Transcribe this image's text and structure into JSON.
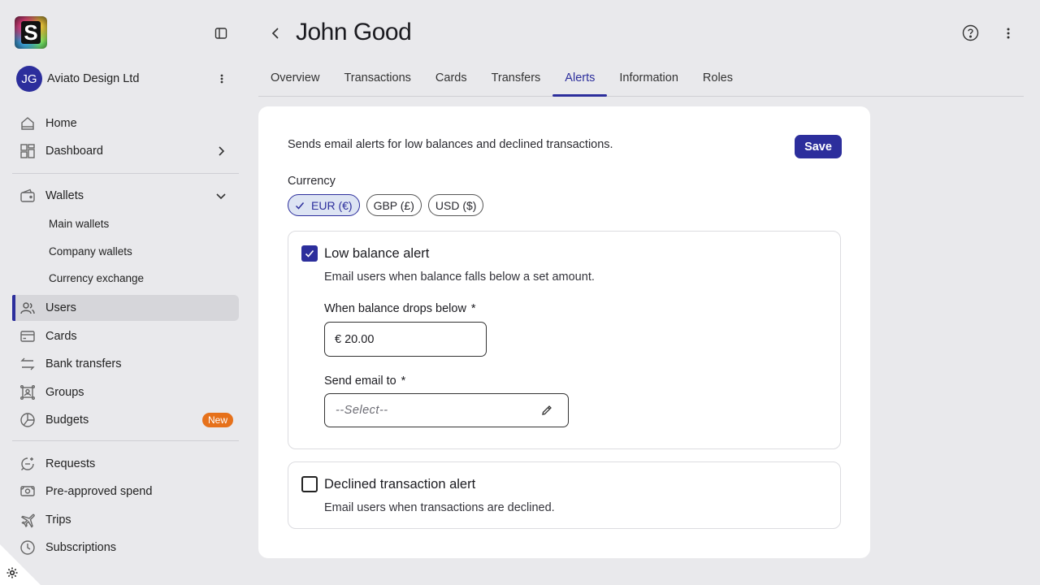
{
  "app": {
    "logo_letter": "S"
  },
  "org": {
    "initials": "JG",
    "name": "Aviato Design Ltd"
  },
  "sidebar": {
    "items": [
      {
        "key": "home",
        "label": "Home",
        "icon": "home-icon"
      },
      {
        "key": "dashboard",
        "label": "Dashboard",
        "icon": "dashboard-icon"
      },
      {
        "key": "wallets",
        "label": "Wallets",
        "icon": "wallet-icon"
      },
      {
        "key": "users",
        "label": "Users",
        "icon": "users-icon",
        "active": true
      },
      {
        "key": "cards",
        "label": "Cards",
        "icon": "card-icon"
      },
      {
        "key": "bank-transfers",
        "label": "Bank transfers",
        "icon": "transfer-icon"
      },
      {
        "key": "groups",
        "label": "Groups",
        "icon": "groups-icon"
      },
      {
        "key": "budgets",
        "label": "Budgets",
        "icon": "budget-icon",
        "badge": "New"
      },
      {
        "key": "requests",
        "label": "Requests",
        "icon": "requests-icon"
      },
      {
        "key": "pre-approved",
        "label": "Pre-approved spend",
        "icon": "pre-approved-icon"
      },
      {
        "key": "trips",
        "label": "Trips",
        "icon": "plane-icon"
      },
      {
        "key": "subscriptions",
        "label": "Subscriptions",
        "icon": "clock-icon"
      }
    ],
    "wallet_subitems": [
      "Main wallets",
      "Company wallets",
      "Currency exchange"
    ]
  },
  "header": {
    "title": "John Good",
    "tabs": [
      "Overview",
      "Transactions",
      "Cards",
      "Transfers",
      "Alerts",
      "Information",
      "Roles"
    ],
    "active_tab": "Alerts"
  },
  "alerts": {
    "description": "Sends email alerts for low balances and declined transactions.",
    "save_label": "Save",
    "currency_label": "Currency",
    "currencies": [
      "EUR (€)",
      "GBP (£)",
      "USD ($)"
    ],
    "selected_currency": "EUR (€)",
    "low_balance": {
      "checked": true,
      "title": "Low balance alert",
      "subtitle": "Email users when balance falls below a set amount.",
      "threshold_label": "When balance drops below",
      "threshold_value": "€ 20.00",
      "email_label": "Send email to",
      "email_placeholder": "--Select--",
      "required_mark": "*"
    },
    "declined": {
      "checked": false,
      "title": "Declined transaction alert",
      "subtitle": "Email users when transactions are declined."
    }
  },
  "colors": {
    "accent": "#2c2e9c",
    "badge": "#e6711b",
    "background": "#e9e9ec"
  }
}
